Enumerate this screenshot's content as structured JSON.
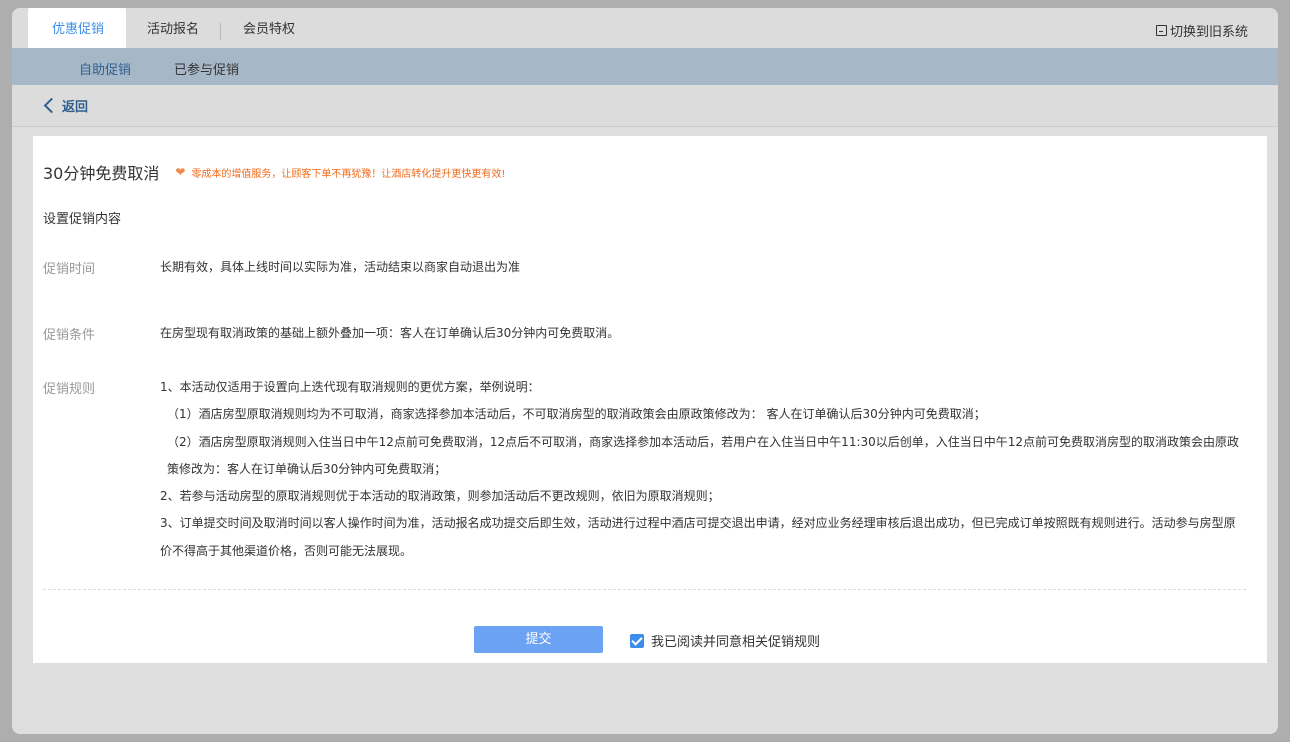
{
  "tabs": [
    {
      "label": "优惠促销",
      "active": true
    },
    {
      "label": "活动报名",
      "active": false
    },
    {
      "label": "会员特权",
      "active": false
    }
  ],
  "switch_label": "切换到旧系统",
  "subnav": [
    {
      "label": "自助促销",
      "active": true
    },
    {
      "label": "已参与促销",
      "active": false
    }
  ],
  "back_label": "返回",
  "promo": {
    "title": "30分钟免费取消",
    "note": "零成本的增值服务，让顾客下单不再犹豫！让酒店转化提升更快更有效!",
    "section_title": "设置促销内容",
    "time_label": "促销时间",
    "time_value": "长期有效，具体上线时间以实际为准，活动结束以商家自动退出为准",
    "condition_label": "促销条件",
    "condition_value": "在房型现有取消政策的基础上额外叠加一项：客人在订单确认后30分钟内可免费取消。",
    "rules_label": "促销规则",
    "rules": [
      "1、本活动仅适用于设置向上迭代现有取消规则的更优方案，举例说明：",
      "（1）酒店房型原取消规则均为不可取消，商家选择参加本活动后，不可取消房型的取消政策会由原政策修改为： 客人在订单确认后30分钟内可免费取消；",
      "（2）酒店房型原取消规则入住当日中午12点前可免费取消，12点后不可取消，商家选择参加本活动后，若用户在入住当日中午11:30以后创单，入住当日中午12点前可免费取消房型的取消政策会由原政策修改为：客人在订单确认后30分钟内可免费取消；",
      "2、若参与活动房型的原取消规则优于本活动的取消政策，则参加活动后不更改规则，依旧为原取消规则；",
      "3、订单提交时间及取消时间以客人操作时间为准，活动报名成功提交后即生效，活动进行过程中酒店可提交退出申请，经对应业务经理审核后退出成功，但已完成订单按照既有规则进行。活动参与房型原价不得高于其他渠道价格，否则可能无法展现。"
    ]
  },
  "submit_label": "提交",
  "agree": {
    "label": "我已阅读并同意相关促销规则",
    "checked": true
  },
  "colors": {
    "accent": "#3d8ee8",
    "submit": "#6ca2f4",
    "note": "#f26a1b"
  }
}
